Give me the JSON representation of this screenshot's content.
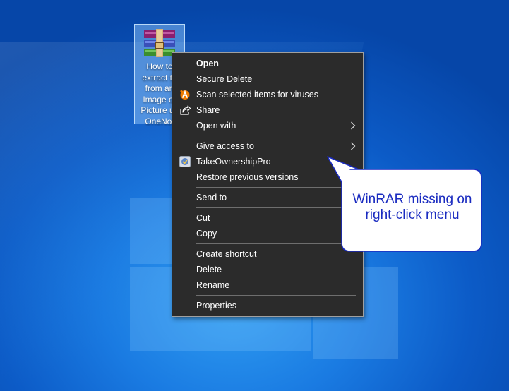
{
  "desktop_icon": {
    "label": "How to\nextract te\nfrom an\nImage or\nPicture us\nOneNot"
  },
  "context_menu": {
    "items": [
      {
        "label": "Open"
      },
      {
        "label": "Secure Delete"
      },
      {
        "label": "Scan selected items for viruses",
        "icon": "avast-icon"
      },
      {
        "label": "Share",
        "icon": "share-icon"
      },
      {
        "label": "Open with"
      },
      {
        "label": "Give access to"
      },
      {
        "label": "TakeOwnershipPro",
        "icon": "takeownershippro-icon"
      },
      {
        "label": "Restore previous versions"
      },
      {
        "label": "Send to"
      },
      {
        "label": "Cut"
      },
      {
        "label": "Copy"
      },
      {
        "label": "Create shortcut"
      },
      {
        "label": "Delete"
      },
      {
        "label": "Rename"
      },
      {
        "label": "Properties"
      }
    ]
  },
  "callout": {
    "text": "WinRAR missing on\nright-click menu"
  },
  "colors": {
    "menu_background": "#2b2b2b",
    "menu_text": "#ffffff",
    "callout_text": "#1a2bc0",
    "callout_border": "#1a2bc0",
    "avast_orange": "#f07c00"
  }
}
